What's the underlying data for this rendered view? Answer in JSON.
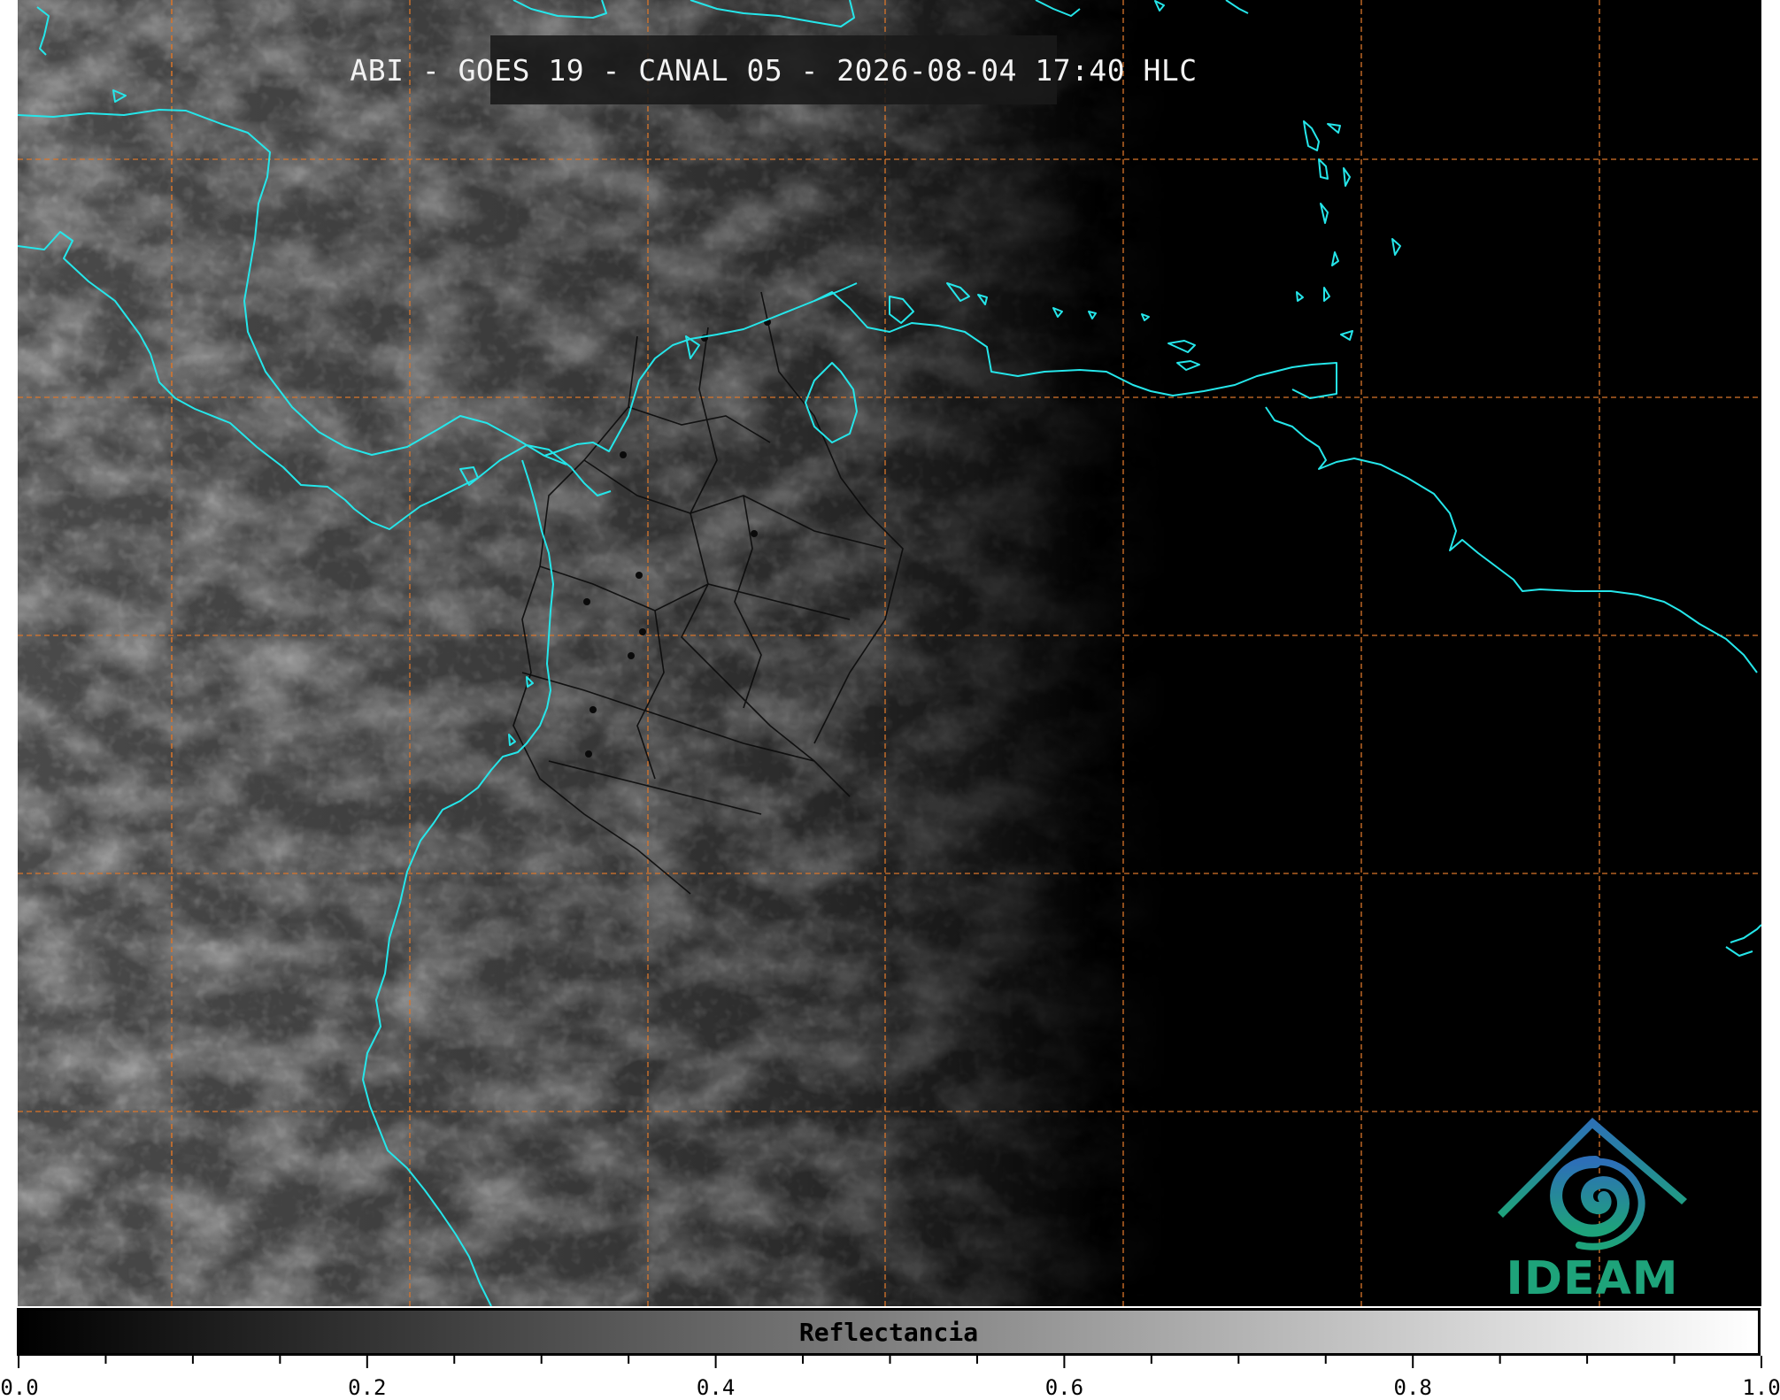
{
  "title": "ABI - GOES 19 - CANAL 05 - 2026-08-04 17:40 HLC",
  "colorbar": {
    "label": "Reflectancia",
    "min": 0.0,
    "max": 1.0,
    "tick_labels": [
      "0.0",
      "0.2",
      "0.4",
      "0.6",
      "0.8",
      "1.0"
    ],
    "colormap": "greys (black to white)"
  },
  "logo": {
    "text": "IDEAM",
    "color_green": "#1ea37a",
    "color_blue": "#2d6fb8"
  },
  "colors": {
    "coastline": "#25e6ea",
    "graticule": "#d9752a",
    "borders": "#0a0a0a",
    "background": "#000000"
  },
  "icons": [
    "ideam-logo-icon"
  ]
}
